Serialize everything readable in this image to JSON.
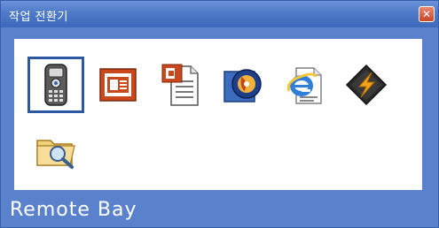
{
  "window": {
    "title": "작업 전환기",
    "close_label": "✕"
  },
  "icons": [
    {
      "name": "remote-control-icon",
      "selected": true
    },
    {
      "name": "presentation-icon",
      "selected": false
    },
    {
      "name": "powerpoint-document-icon",
      "selected": false
    },
    {
      "name": "media-player-icon",
      "selected": false
    },
    {
      "name": "internet-explorer-icon",
      "selected": false
    },
    {
      "name": "winamp-icon",
      "selected": false
    },
    {
      "name": "search-folder-icon",
      "selected": false
    }
  ],
  "status": {
    "selected_task": "Remote Bay"
  },
  "colors": {
    "frame": "#5a82cc",
    "selection_border": "#2b58a5",
    "close_button": "#d35a3d"
  }
}
